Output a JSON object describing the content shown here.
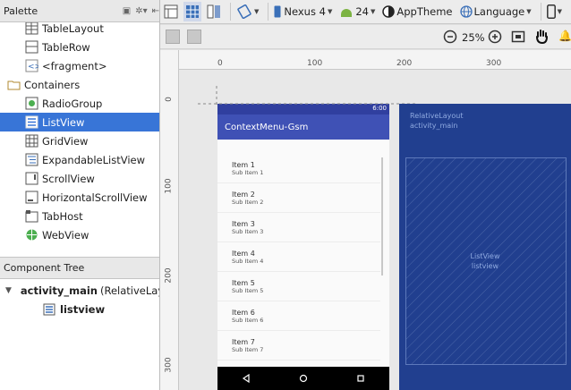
{
  "palette": {
    "title": "Palette",
    "items": [
      {
        "label": "TableLayout",
        "icon": "table-layout-icon"
      },
      {
        "label": "TableRow",
        "icon": "table-row-icon"
      },
      {
        "label": "<fragment>",
        "icon": "fragment-icon"
      },
      {
        "label": "Containers",
        "icon": "folder-icon"
      },
      {
        "label": "RadioGroup",
        "icon": "radio-group-icon"
      },
      {
        "label": "ListView",
        "icon": "list-view-icon"
      },
      {
        "label": "GridView",
        "icon": "grid-view-icon"
      },
      {
        "label": "ExpandableListView",
        "icon": "expandable-list-icon"
      },
      {
        "label": "ScrollView",
        "icon": "scroll-view-icon"
      },
      {
        "label": "HorizontalScrollView",
        "icon": "horizontal-scroll-icon"
      },
      {
        "label": "TabHost",
        "icon": "tab-host-icon"
      },
      {
        "label": "WebView",
        "icon": "web-view-icon"
      }
    ],
    "selected": "ListView"
  },
  "component_tree": {
    "title": "Component Tree",
    "root_label": "activity_main",
    "root_type": "(RelativeLayout)",
    "child_label": "listview"
  },
  "toolbar": {
    "device": "Nexus 4",
    "api": "24",
    "theme": "AppTheme",
    "language": "Language",
    "zoom": "25%"
  },
  "rulers": {
    "top": [
      "0",
      "100",
      "200",
      "300"
    ],
    "left": [
      "0",
      "100",
      "200",
      "300"
    ]
  },
  "preview": {
    "time": "6:00",
    "app_title": "ContextMenu-Gsm",
    "items": [
      {
        "title": "Item 1",
        "sub": "Sub Item 1"
      },
      {
        "title": "Item 2",
        "sub": "Sub Item 2"
      },
      {
        "title": "Item 3",
        "sub": "Sub Item 3"
      },
      {
        "title": "Item 4",
        "sub": "Sub Item 4"
      },
      {
        "title": "Item 5",
        "sub": "Sub Item 5"
      },
      {
        "title": "Item 6",
        "sub": "Sub Item 6"
      },
      {
        "title": "Item 7",
        "sub": "Sub Item 7"
      }
    ]
  },
  "blueprint": {
    "root_type": "RelativeLayout",
    "root_id": "activity_main",
    "child_type": "ListView",
    "child_id": "listview"
  },
  "colors": {
    "selection": "#3875d7",
    "primary": "#3f51b5",
    "primary_dark": "#303f9f",
    "blueprint": "#213f8f"
  }
}
